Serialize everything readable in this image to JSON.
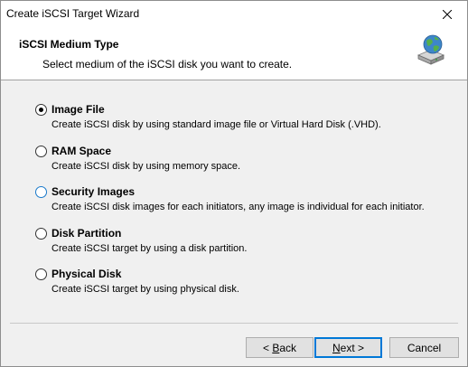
{
  "window": {
    "title": "Create iSCSI Target Wizard"
  },
  "header": {
    "title": "iSCSI Medium Type",
    "subtitle": "Select medium of the iSCSI disk you want to create.",
    "icon": "network-disk-globe-icon"
  },
  "options": [
    {
      "label": "Image File",
      "description": "Create iSCSI disk by using standard image file or Virtual Hard Disk (.VHD).",
      "selected": true
    },
    {
      "label": "RAM Space",
      "description": "Create iSCSI disk by using memory space.",
      "selected": false
    },
    {
      "label": "Security Images",
      "description": "Create iSCSI disk images for each initiators, any image is individual for each initiator.",
      "selected": false
    },
    {
      "label": "Disk Partition",
      "description": "Create iSCSI target by using a disk partition.",
      "selected": false
    },
    {
      "label": "Physical Disk",
      "description": "Create iSCSI target by using physical disk.",
      "selected": false
    }
  ],
  "buttons": {
    "back_prefix": "< ",
    "back_accel": "B",
    "back_rest": "ack",
    "next_accel": "N",
    "next_rest": "ext >",
    "cancel": "Cancel"
  }
}
